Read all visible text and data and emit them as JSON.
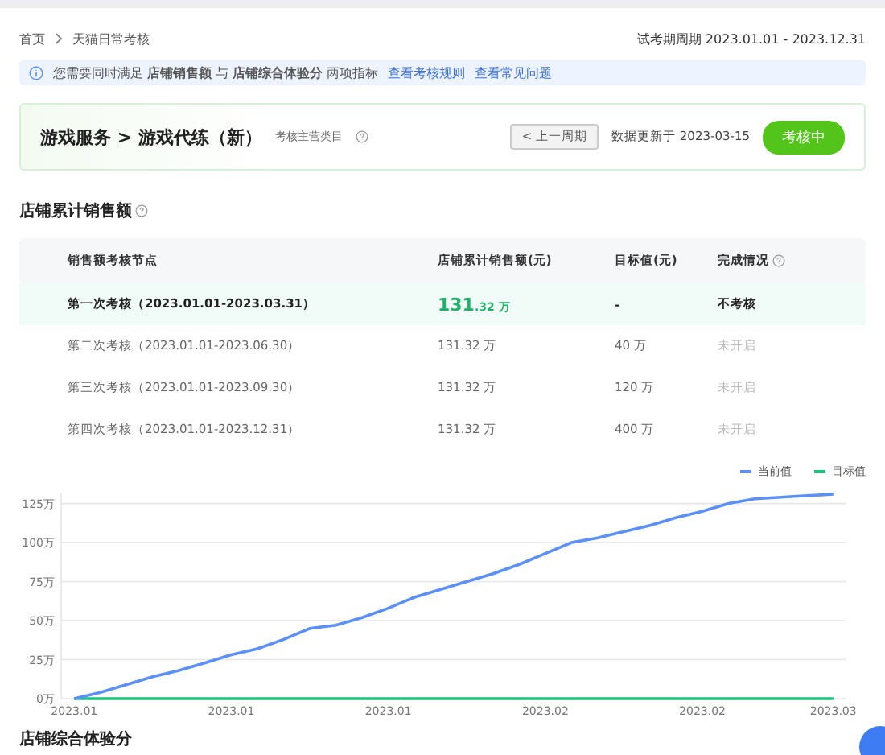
{
  "breadcrumb": [
    "首页",
    "天猫日常考核"
  ],
  "period": "试考期周期 2023.01.01 - 2023.12.31",
  "notice": {
    "text": "您需要同时满足 **店铺销售额** 与 **店铺综合体验分** 两项指标",
    "links": [
      "查看考核规则",
      "查看常见问题"
    ]
  },
  "category": {
    "title": "游戏服务 > 游戏代练（新）",
    "subtitle": "考核主营类目",
    "prev_button": "< 上一周期",
    "updated": "数据更新于 2023-03-15",
    "status": "考核中"
  },
  "sales_section": {
    "title": "店铺累计销售额",
    "table": {
      "columns": [
        "销售额考核节点",
        "店铺累计销售额(元)",
        "目标值(元)",
        "完成情况"
      ],
      "rows": [
        {
          "node": "第一次考核（2023.01.01-2023.03.31）",
          "sales_main": "131",
          "sales_decimal": ".32 万",
          "target": "-",
          "status": "不考核",
          "selected": true
        },
        {
          "node": "第二次考核（2023.01.01-2023.06.30）",
          "sales_main": "131.32 万",
          "target": "40 万",
          "status": "未开启",
          "selected": false
        },
        {
          "node": "第三次考核（2023.01.01-2023.09.30）",
          "sales_main": "131.32 万",
          "target": "120 万",
          "status": "未开启",
          "selected": false
        },
        {
          "node": "第四次考核（2023.01.01-2023.12.31）",
          "sales_main": "131.32 万",
          "target": "400 万",
          "status": "未开启",
          "selected": false
        }
      ]
    },
    "chart_data": {
      "type": "line",
      "categories": [
        "2023.01",
        null,
        null,
        null,
        null,
        null,
        "2023.01",
        null,
        null,
        null,
        null,
        null,
        "2023.01",
        null,
        null,
        null,
        null,
        null,
        "2023.02",
        null,
        null,
        null,
        null,
        null,
        "2023.02",
        null,
        null,
        null,
        null,
        "2023.03"
      ],
      "yticks": [
        {
          "value": 0,
          "label": "0万"
        },
        {
          "value": 25,
          "label": "25万"
        },
        {
          "value": 50,
          "label": "50万"
        },
        {
          "value": 75,
          "label": "75万"
        },
        {
          "value": 100,
          "label": "100万"
        },
        {
          "value": 125,
          "label": "125万"
        }
      ],
      "grid": true,
      "ylim": [
        0,
        132
      ],
      "series": [
        {
          "name": "当前值",
          "color": "#5b8ff9",
          "values": [
            0,
            4,
            9,
            14,
            18,
            23,
            28,
            32,
            38,
            45,
            47,
            52,
            58,
            65,
            70,
            75,
            80,
            86,
            93,
            100,
            103,
            107,
            111,
            116,
            120,
            125,
            128,
            129,
            130,
            131
          ]
        },
        {
          "name": "目标值",
          "color": "#1ec27a",
          "values": [
            0,
            0,
            0,
            0,
            0,
            0,
            0,
            0,
            0,
            0,
            0,
            0,
            0,
            0,
            0,
            0,
            0,
            0,
            0,
            0,
            0,
            0,
            0,
            0,
            0,
            0,
            0,
            0,
            0,
            0
          ]
        }
      ]
    }
  },
  "next_section": {
    "title": "店铺综合体验分"
  }
}
